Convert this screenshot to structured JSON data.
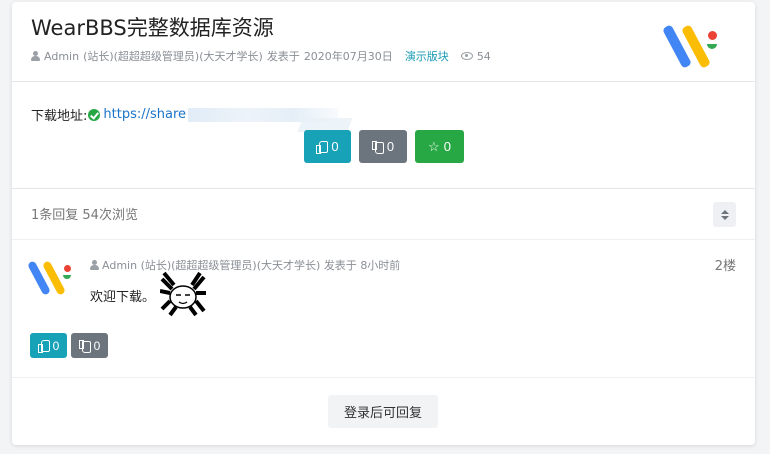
{
  "post": {
    "title": "WearBBS完整数据库资源",
    "author": "Admin",
    "author_role": "(站长)(超超超级管理员)(大天才学长)",
    "posted_label": "发表于",
    "posted_date": "2020年07月30日",
    "category": "演示版块",
    "views": "54"
  },
  "body": {
    "download_label": "下载地址:",
    "download_link": "https://share"
  },
  "votes": {
    "like_count": "0",
    "dislike_count": "0",
    "star_count": "0"
  },
  "summary": {
    "text": "1条回复 54次浏览"
  },
  "reply": {
    "author": "Admin",
    "author_role": "(站长)(超超超级管理员)(大天才学长)",
    "posted_label": "发表于",
    "posted_time": "8小时前",
    "floor": "2楼",
    "content": "欢迎下载。",
    "like_count": "0",
    "dislike_count": "0"
  },
  "footer": {
    "login_reply_label": "登录后可回复"
  },
  "colors": {
    "logo_blue": "#4285f4",
    "logo_yellow": "#fbbc04",
    "logo_red": "#ea4335",
    "logo_green": "#34a853",
    "btn_info": "#17a2b8",
    "btn_gray": "#6c757d",
    "btn_green": "#28a745"
  },
  "icons": [
    "user-icon",
    "eye-icon",
    "check-icon",
    "thumbs-up-icon",
    "thumbs-down-icon",
    "star-icon",
    "sort-icon"
  ]
}
